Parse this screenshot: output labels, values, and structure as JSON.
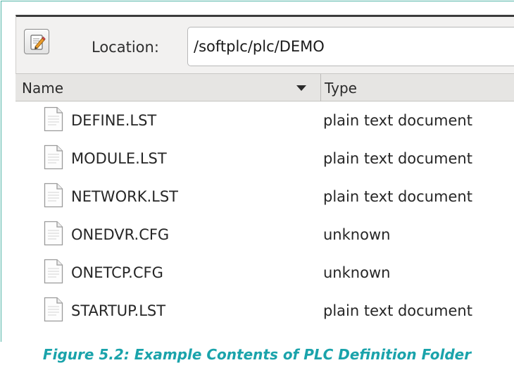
{
  "toolbar": {
    "edit_icon": "pencil-notepad-icon",
    "location_label": "Location:",
    "location_value": "/softplc/plc/DEMO"
  },
  "header": {
    "name_label": "Name",
    "type_label": "Type",
    "sort_icon": "sort-descending-icon"
  },
  "files": [
    {
      "name": "DEFINE.LST",
      "type": "plain text document",
      "icon": "text-file-icon"
    },
    {
      "name": "MODULE.LST",
      "type": "plain text document",
      "icon": "text-file-icon"
    },
    {
      "name": "NETWORK.LST",
      "type": "plain text document",
      "icon": "text-file-icon"
    },
    {
      "name": "ONEDVR.CFG",
      "type": "unknown",
      "icon": "text-file-icon"
    },
    {
      "name": "ONETCP.CFG",
      "type": "unknown",
      "icon": "text-file-icon"
    },
    {
      "name": "STARTUP.LST",
      "type": "plain text document",
      "icon": "text-file-icon"
    }
  ],
  "caption": "Figure 5.2: Example Contents of PLC Definition Folder",
  "colors": {
    "caption": "#1aa3ab",
    "frame_border": "#4fb3a5"
  }
}
